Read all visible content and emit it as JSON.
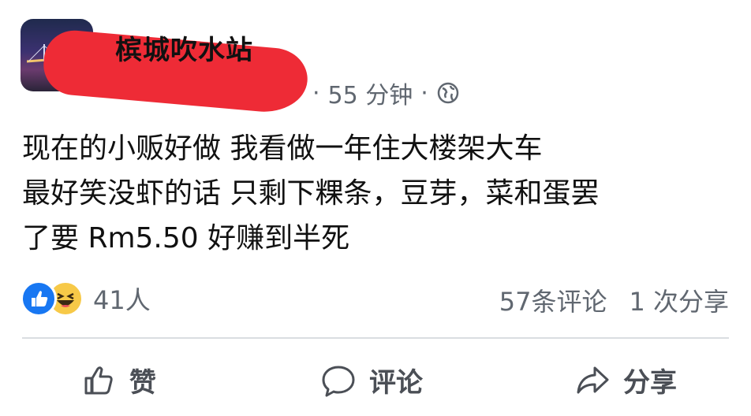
{
  "post": {
    "page_name": "槟城吹水站",
    "time_ago": "55 分钟",
    "separator": "·",
    "privacy_icon": "globe-icon",
    "avatar_icon": "page-avatar",
    "text_lines": [
      "现在的小贩好做 我看做一年住大楼架大车",
      "最好笑没虾的话 只剩下粿条，豆芽，菜和蛋罢",
      "了要 Rm5.50 好赚到半死"
    ]
  },
  "engagement": {
    "reaction_icons": [
      "like-icon",
      "haha-icon"
    ],
    "reaction_count": "41人",
    "comments": "57条评论",
    "shares": "1 次分享"
  },
  "actions": {
    "like_label": "赞",
    "comment_label": "评论",
    "share_label": "分享"
  },
  "colors": {
    "redaction": "#ee2b36",
    "like_blue": "#1877f2",
    "haha_yellow": "#f7c948",
    "meta_gray": "#606770"
  }
}
